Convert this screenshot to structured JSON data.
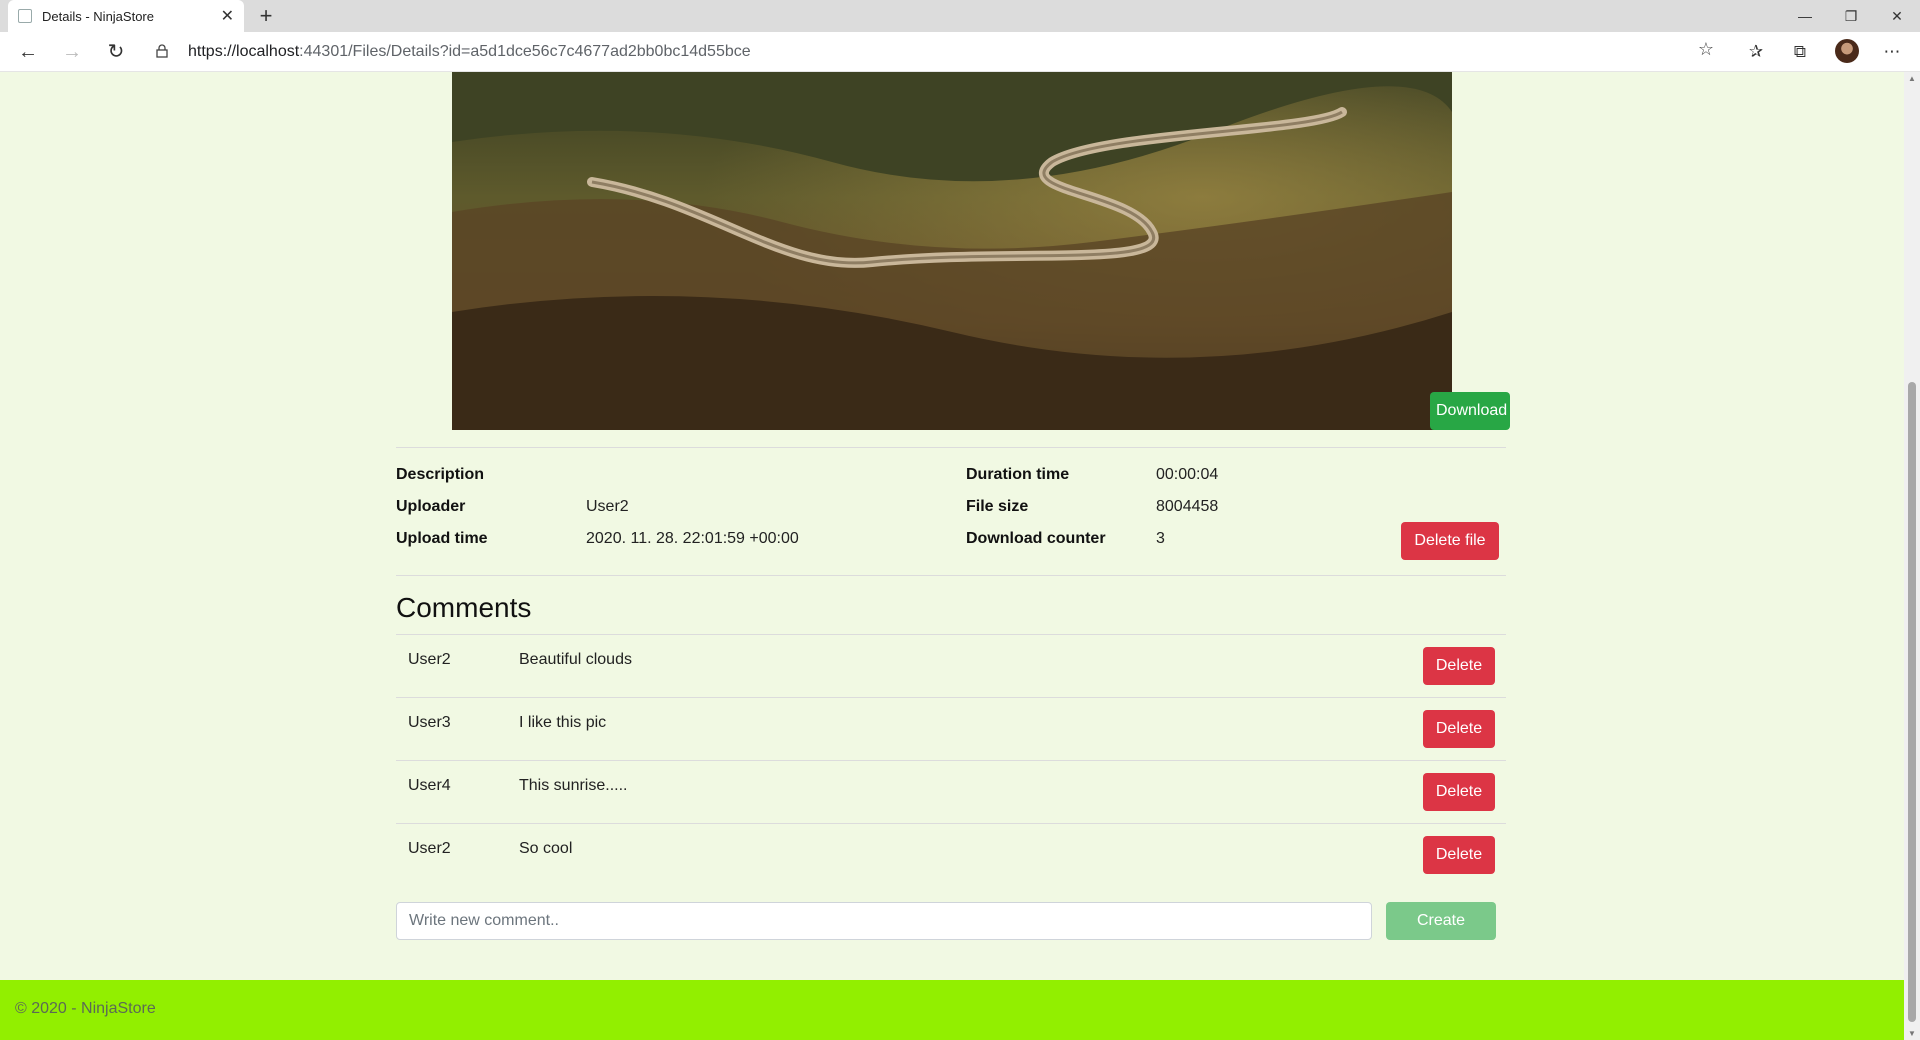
{
  "browser": {
    "tab_title": "Details - NinjaStore",
    "url_host": "https://localhost",
    "url_rest": ":44301/Files/Details?id=a5d1dce56c7c4677ad2bb0bc14d55bce",
    "icons": [
      "back-icon",
      "forward-icon",
      "refresh-icon",
      "lock-icon",
      "star-icon",
      "favorites-icon",
      "collections-icon",
      "profile-avatar",
      "more-icon"
    ]
  },
  "file": {
    "download_label": "Download",
    "delete_label": "Delete file",
    "details": [
      {
        "label": "Description",
        "value": ""
      },
      {
        "label": "Uploader",
        "value": "User2"
      },
      {
        "label": "Upload time",
        "value": "2020. 11. 28. 22:01:59 +00:00"
      },
      {
        "label": "Duration time",
        "value": "00:00:04"
      },
      {
        "label": "File size",
        "value": "8004458"
      },
      {
        "label": "Download counter",
        "value": "3"
      }
    ]
  },
  "comments": {
    "heading": "Comments",
    "items": [
      {
        "user": "User2",
        "text": "Beautiful clouds",
        "delete_label": "Delete"
      },
      {
        "user": "User3",
        "text": "I like this pic",
        "delete_label": "Delete"
      },
      {
        "user": "User4",
        "text": "This sunrise.....",
        "delete_label": "Delete"
      },
      {
        "user": "User2",
        "text": "So cool",
        "delete_label": "Delete"
      }
    ],
    "new_comment_placeholder": "Write new comment..",
    "create_label": "Create"
  },
  "footer": {
    "text": "© 2020 - NinjaStore"
  },
  "colors": {
    "page_bg": "#f1f9e3",
    "footer_bg": "#92ef00",
    "success": "#28a745",
    "danger": "#dc3545"
  }
}
